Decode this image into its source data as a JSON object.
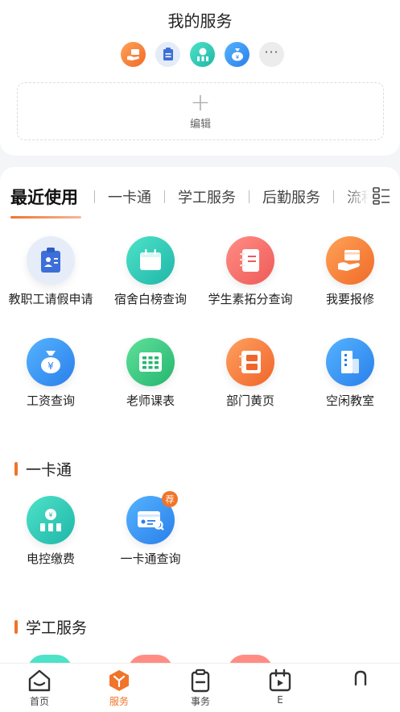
{
  "header": {
    "title": "我的服务"
  },
  "favorites": {
    "icons": [
      "hand-card-icon",
      "leave-badge-icon",
      "power-meter-icon",
      "money-bag-icon",
      "more-icon"
    ],
    "more_label": "···"
  },
  "edit": {
    "label": "编辑",
    "plus": "+"
  },
  "tabs": [
    "最近使用",
    "一卡通",
    "学工服务",
    "后勤服务",
    "流程"
  ],
  "recent_apps": [
    {
      "label": "教职工请假申请",
      "icon": "leave-badge-icon"
    },
    {
      "label": "宿舍白榜查询",
      "icon": "calendar-list-icon"
    },
    {
      "label": "学生素拓分查询",
      "icon": "notebook-icon"
    },
    {
      "label": "我要报修",
      "icon": "hand-card-icon"
    },
    {
      "label": "工资查询",
      "icon": "money-bag-icon"
    },
    {
      "label": "老师课表",
      "icon": "timetable-icon"
    },
    {
      "label": "部门黄页",
      "icon": "yellow-pages-icon"
    },
    {
      "label": "空闲教室",
      "icon": "building-icon"
    }
  ],
  "sections": [
    {
      "title": "一卡通",
      "apps": [
        {
          "label": "电控缴费",
          "icon": "power-meter-icon"
        },
        {
          "label": "一卡通查询",
          "icon": "card-search-icon",
          "badge": "荐"
        }
      ]
    },
    {
      "title": "学工服务",
      "apps": []
    }
  ],
  "bottom_nav": [
    {
      "label": "首页",
      "icon": "home-icon"
    },
    {
      "label": "服务",
      "icon": "cube-icon",
      "active": true
    },
    {
      "label": "事务",
      "icon": "clipboard-icon"
    },
    {
      "label": "E",
      "icon": "calendar-icon"
    },
    {
      "label": "",
      "icon": "user-icon"
    }
  ],
  "colors": {
    "accent": "#f0742a",
    "blue": "#3a8ef0",
    "teal": "#2cc3b0",
    "red": "#f0656a",
    "orange": "#f78a3a"
  }
}
